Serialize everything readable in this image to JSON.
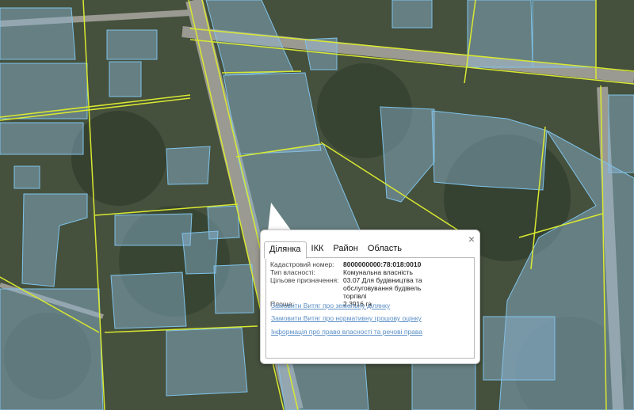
{
  "popup": {
    "close_glyph": "×",
    "tabs": [
      {
        "label": "Ділянка",
        "active": true
      },
      {
        "label": "ІКК",
        "active": false
      },
      {
        "label": "Район",
        "active": false
      },
      {
        "label": "Область",
        "active": false
      }
    ],
    "info": [
      {
        "label": "Кадастровий номер:",
        "value": "8000000000:78:018:0010"
      },
      {
        "label": "Тип власності:",
        "value": "Комунальна власність"
      },
      {
        "label": "Цільове призначення:",
        "value": "03.07 Для будівництва та обслуговування будівель торгівлі"
      },
      {
        "label": "Площа:",
        "value": "2.3916 га"
      }
    ],
    "links": [
      "Замовити Витяг про земельну ділянку",
      "Замовити Витяг про нормативну грошову оцінку",
      "Інформація про право власності та речові права"
    ]
  },
  "map": {
    "colors": {
      "parcel_fill": "#8fb7d8",
      "parcel_stroke": "#7ec3ea",
      "boundary": "#d8e830",
      "road": "#9a9a92",
      "vegetation": "#3d4a34"
    }
  }
}
